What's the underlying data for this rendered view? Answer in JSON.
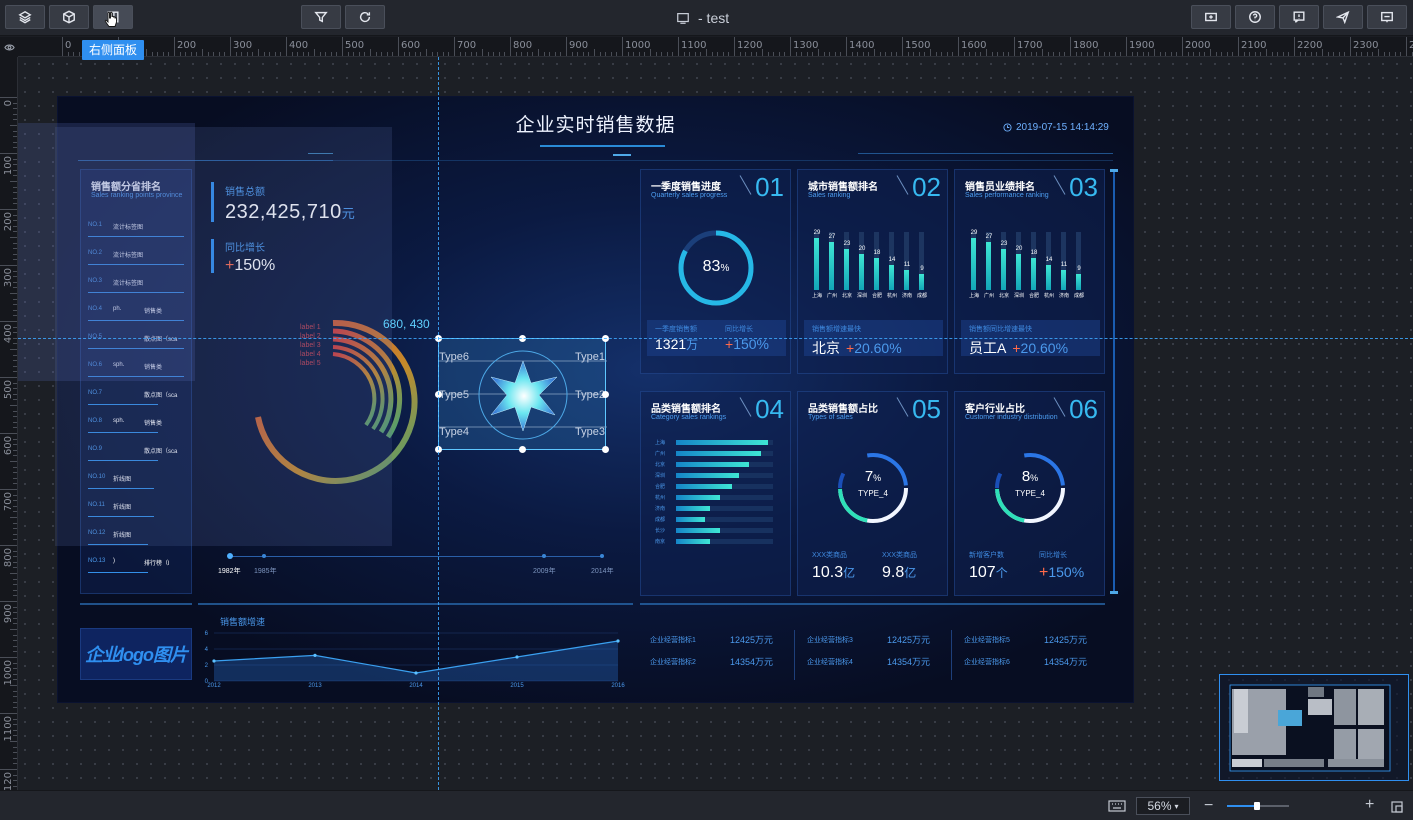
{
  "toolbar": {
    "left_icons": [
      "layers-icon",
      "cube-icon",
      "panel-icon"
    ],
    "center_icons": [
      "filter-icon",
      "refresh-icon"
    ],
    "right_icons": [
      "publish-icon",
      "help-icon",
      "feedback-icon",
      "send-icon",
      "preview-icon"
    ],
    "doc_title": "- test",
    "tooltip": "右侧面板"
  },
  "ruler": {
    "h_labels": [
      "0",
      "100",
      "200",
      "300",
      "400",
      "500",
      "600",
      "700",
      "800",
      "900",
      "1000",
      "1100",
      "1200",
      "1300",
      "1400",
      "1500",
      "1600",
      "1700",
      "1800",
      "1900",
      "2000",
      "2100",
      "2200",
      "2300",
      "24"
    ],
    "v_labels": [
      "0",
      "100",
      "200",
      "300",
      "400",
      "500",
      "600",
      "700",
      "800",
      "900",
      "1000",
      "1100",
      "120"
    ]
  },
  "canvas": {
    "coord_readout": "680, 430"
  },
  "dashboard": {
    "title": "企业实时销售数据",
    "time": "2019-07-15 14:14:29",
    "left": {
      "rank_title": "销售额分省排名",
      "rank_sub": "Sales ranking points province",
      "rank_rows": [
        {
          "no": "NO.1",
          "name": "流计标签图"
        },
        {
          "no": "NO.2",
          "name": "流计标签图"
        },
        {
          "no": "NO.3",
          "name": "流计标签图"
        },
        {
          "no": "NO.4",
          "name": "ph.",
          "extra": "销售类"
        },
        {
          "no": "NO.5",
          "name": "",
          "extra": "散点图（sca"
        },
        {
          "no": "NO.6",
          "name": "sph.",
          "extra": "销售类"
        },
        {
          "no": "NO.7",
          "name": "",
          "extra": "散点图（sca"
        },
        {
          "no": "NO.8",
          "name": "sph.",
          "extra": "销售类"
        },
        {
          "no": "NO.9",
          "name": "",
          "extra": "散点图（sca"
        },
        {
          "no": "NO.10",
          "name": "折线图"
        },
        {
          "no": "NO.11",
          "name": "折线图"
        },
        {
          "no": "NO.12",
          "name": "折线图"
        },
        {
          "no": "NO.13",
          "name": ")",
          "extra": "排行榜（l"
        }
      ],
      "total_label": "销售总额",
      "total_value": "232,425,710",
      "total_unit": "元",
      "growth_label": "同比增长",
      "growth_value": "150%",
      "growth_sign": "+",
      "rose_labels": [
        "label 1",
        "label 2",
        "label 3",
        "label 4",
        "label 5"
      ],
      "timeline": [
        "1982年",
        "1985年",
        "2009年",
        "2014年"
      ]
    },
    "radar": {
      "labels": [
        "Type6",
        "Type1",
        "Type5",
        "Type2",
        "Type4",
        "Type3"
      ]
    },
    "cards": [
      {
        "title": "一季度销售进度",
        "sub": "Quarterly sales progress",
        "num": "01",
        "gauge": "83",
        "gauge_unit": "%",
        "stat1_label": "一季度销售额",
        "stat1_value": "1321",
        "stat1_unit": "万",
        "stat2_label": "同比增长",
        "stat2_value": "150%"
      },
      {
        "title": "城市销售额排名",
        "sub": "Sales ranking",
        "num": "02",
        "stat_label": "销售额增速最快",
        "stat_city": "北京",
        "stat_value": "20.60%"
      },
      {
        "title": "销售员业绩排名",
        "sub": "Sales performance ranking",
        "num": "03",
        "stat_label": "销售额同比增速最快",
        "stat_city": "员工A",
        "stat_value": "20.60%"
      },
      {
        "title": "品类销售额排名",
        "sub": "Category sales rankings",
        "num": "04"
      },
      {
        "title": "品类销售额占比",
        "sub": "Types of sales",
        "num": "05",
        "ring_value": "7",
        "ring_unit": "%",
        "ring_type": "TYPE_4",
        "s1_label": "XXX类商品",
        "s1_value": "10.3",
        "s1_unit": "亿",
        "s2_label": "XXX类商品",
        "s2_value": "9.8",
        "s2_unit": "亿"
      },
      {
        "title": "客户行业占比",
        "sub": "Customer industry distribution",
        "num": "06",
        "ring_value": "8",
        "ring_unit": "%",
        "ring_type": "TYPE_4",
        "s1_label": "新增客户数",
        "s1_value": "107",
        "s1_unit": "个",
        "s2_label": "同比增长",
        "s2_value": "150%"
      }
    ],
    "city_bars": {
      "categories": [
        "上海",
        "广州",
        "北京",
        "深圳",
        "合肥",
        "杭州",
        "济南",
        "成都"
      ],
      "values": [
        29,
        27,
        23,
        20,
        18,
        14,
        11,
        9
      ]
    },
    "staff_bars": {
      "categories": [
        "上海",
        "广州",
        "北京",
        "深圳",
        "合肥",
        "杭州",
        "济南",
        "成都"
      ],
      "values": [
        29,
        27,
        23,
        20,
        18,
        14,
        11,
        9
      ]
    },
    "category_bars": {
      "categories": [
        "上海",
        "广州",
        "北京",
        "深圳",
        "合肥",
        "杭州",
        "济南",
        "成都",
        "长沙",
        "南京"
      ],
      "values": [
        95,
        88,
        75,
        65,
        58,
        45,
        35,
        30,
        45,
        35
      ]
    },
    "bottom": {
      "logo": "企业logo图片",
      "line_title": "销售额增速",
      "metrics": [
        {
          "label": "企业经营指标1",
          "value": "12425万元"
        },
        {
          "label": "企业经营指标2",
          "value": "14354万元"
        },
        {
          "label": "企业经营指标3",
          "value": "12425万元"
        },
        {
          "label": "企业经营指标4",
          "value": "14354万元"
        },
        {
          "label": "企业经营指标5",
          "value": "12425万元"
        },
        {
          "label": "企业经营指标6",
          "value": "14354万元"
        }
      ]
    }
  },
  "chart_data": {
    "type": "line",
    "title": "销售额增速",
    "x": [
      "2012",
      "2013",
      "2014",
      "2015",
      "2016"
    ],
    "series": [
      {
        "values": [
          2.5,
          3.2,
          1.0,
          3.0,
          5.0
        ]
      }
    ],
    "ylim": [
      0,
      6
    ],
    "yticks": [
      "0",
      "2",
      "4",
      "6"
    ]
  },
  "bottombar": {
    "zoom": "56%"
  }
}
